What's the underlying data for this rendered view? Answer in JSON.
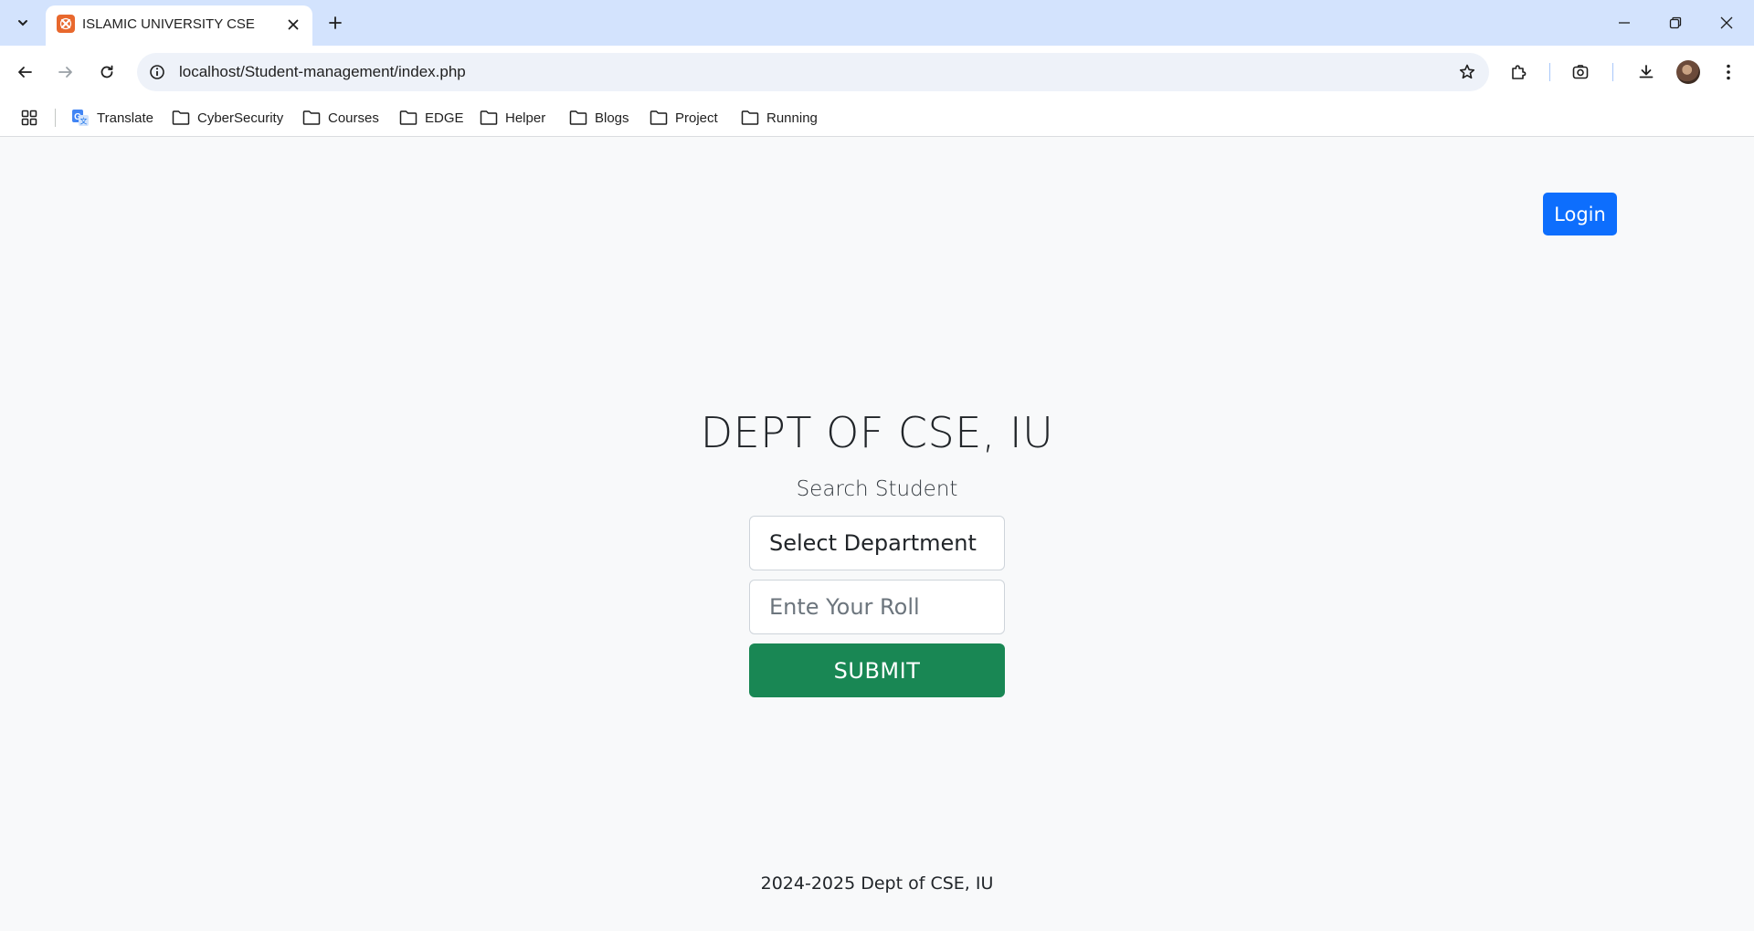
{
  "browser": {
    "tab_title": "ISLAMIC UNIVERSITY CSE",
    "url": "localhost/Student-management/index.php",
    "bookmarks": [
      "Translate",
      "CyberSecurity",
      "Courses",
      "EDGE",
      "Helper",
      "Blogs",
      "Project",
      "Running"
    ]
  },
  "page": {
    "login_label": "Login",
    "heading": "DEPT OF CSE, IU",
    "subheading": "Search Student",
    "department_select": {
      "selected": "Select Department"
    },
    "roll_input": {
      "value": "",
      "placeholder": "Ente Your Roll"
    },
    "submit_label": "SUBMIT",
    "footer": "2024-2025 Dept of CSE, IU"
  },
  "colors": {
    "login_button": "#0d6efd",
    "submit_button": "#198754",
    "tabstrip": "#d3e3fd",
    "page_background": "#f8f9fa"
  }
}
